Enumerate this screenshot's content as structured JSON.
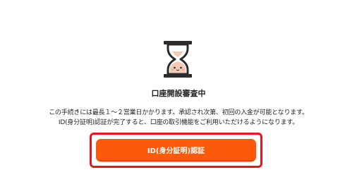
{
  "status": {
    "icon": "hourglass-icon",
    "title": "口座開設審査中"
  },
  "description": {
    "line1": "この手続きには最長１～２営業日かかります。承認され次第、初回の入金が可能となります。",
    "line2": "ID(身分証明)認証が完了すると、口座の取引機能をご利用いただけるようになります。"
  },
  "actions": {
    "verify_label": "ID(身分証明)認証"
  },
  "colors": {
    "button": "#fc5a0b",
    "highlight_frame": "#e8141e",
    "hourglass_frame": "#2b2b2b",
    "hourglass_sand": "#f6c9b5"
  }
}
